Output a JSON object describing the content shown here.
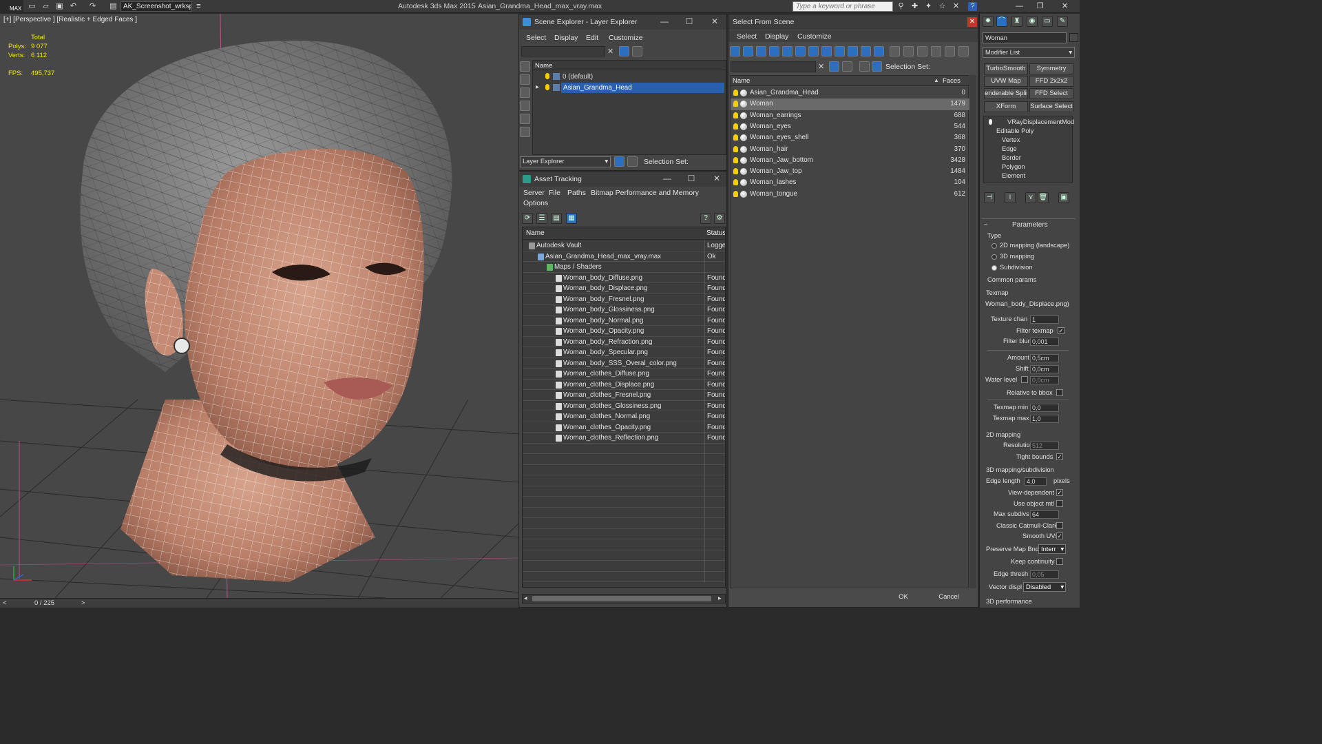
{
  "titlebar": {
    "app_title": "Autodesk 3ds Max  2015",
    "file_title": "Asian_Grandma_Head_max_vray.max",
    "workspace": "AK_Screenshot_wrksp",
    "search_placeholder": "Type a keyword or phrase",
    "icon_label": "MAX"
  },
  "viewport": {
    "label": "[+] [Perspective ] [Realistic + Edged Faces ]",
    "total_label": "Total",
    "polys_label": "Polys:",
    "polys_value": "9 077",
    "verts_label": "Verts:",
    "verts_value": "6 112",
    "fps_label": "FPS:",
    "fps_value": "495,737"
  },
  "timeline": {
    "position": "0 / 225",
    "prev": "<",
    "next": ">"
  },
  "scene_explorer": {
    "title": "Scene Explorer - Layer Explorer",
    "menus": [
      "Select",
      "Display",
      "Edit",
      "Customize"
    ],
    "column": "Name",
    "layers": [
      {
        "name": "0 (default)",
        "selected": false
      },
      {
        "name": "Asian_Grandma_Head",
        "selected": true
      }
    ],
    "footer_dropdown": "Layer Explorer",
    "selection_set_label": "Selection Set:"
  },
  "asset_tracking": {
    "title": "Asset Tracking",
    "menus": [
      "Server",
      "File",
      "Paths",
      "Bitmap Performance and Memory",
      "Options"
    ],
    "columns": [
      "Name",
      "Status"
    ],
    "rows": [
      {
        "name": "Autodesk Vault",
        "status": "Logged",
        "indent": 0,
        "type": "vault"
      },
      {
        "name": "Asian_Grandma_Head_max_vray.max",
        "status": "Ok",
        "indent": 1,
        "type": "file"
      },
      {
        "name": "Maps / Shaders",
        "status": "",
        "indent": 2,
        "type": "folder"
      },
      {
        "name": "Woman_body_Diffuse.png",
        "status": "Found",
        "indent": 3,
        "type": "map"
      },
      {
        "name": "Woman_body_Displace.png",
        "status": "Found",
        "indent": 3,
        "type": "map"
      },
      {
        "name": "Woman_body_Fresnel.png",
        "status": "Found",
        "indent": 3,
        "type": "map"
      },
      {
        "name": "Woman_body_Glossiness.png",
        "status": "Found",
        "indent": 3,
        "type": "map"
      },
      {
        "name": "Woman_body_Normal.png",
        "status": "Found",
        "indent": 3,
        "type": "map"
      },
      {
        "name": "Woman_body_Opacity.png",
        "status": "Found",
        "indent": 3,
        "type": "map"
      },
      {
        "name": "Woman_body_Refraction.png",
        "status": "Found",
        "indent": 3,
        "type": "map"
      },
      {
        "name": "Woman_body_Specular.png",
        "status": "Found",
        "indent": 3,
        "type": "map"
      },
      {
        "name": "Woman_body_SSS_Overal_color.png",
        "status": "Found",
        "indent": 3,
        "type": "map"
      },
      {
        "name": "Woman_clothes_Diffuse.png",
        "status": "Found",
        "indent": 3,
        "type": "map"
      },
      {
        "name": "Woman_clothes_Displace.png",
        "status": "Found",
        "indent": 3,
        "type": "map"
      },
      {
        "name": "Woman_clothes_Fresnel.png",
        "status": "Found",
        "indent": 3,
        "type": "map"
      },
      {
        "name": "Woman_clothes_Glossiness.png",
        "status": "Found",
        "indent": 3,
        "type": "map"
      },
      {
        "name": "Woman_clothes_Normal.png",
        "status": "Found",
        "indent": 3,
        "type": "map"
      },
      {
        "name": "Woman_clothes_Opacity.png",
        "status": "Found",
        "indent": 3,
        "type": "map"
      },
      {
        "name": "Woman_clothes_Reflection.png",
        "status": "Found",
        "indent": 3,
        "type": "map"
      }
    ]
  },
  "select_from_scene": {
    "title": "Select From Scene",
    "menus": [
      "Select",
      "Display",
      "Customize"
    ],
    "selection_set_label": "Selection Set:",
    "columns": [
      "Name",
      "Faces"
    ],
    "objects": [
      {
        "name": "Asian_Grandma_Head",
        "faces": "0",
        "selected": false
      },
      {
        "name": "Woman",
        "faces": "1479",
        "selected": true
      },
      {
        "name": "Woman_earrings",
        "faces": "688",
        "selected": false
      },
      {
        "name": "Woman_eyes",
        "faces": "544",
        "selected": false
      },
      {
        "name": "Woman_eyes_shell",
        "faces": "368",
        "selected": false
      },
      {
        "name": "Woman_hair",
        "faces": "370",
        "selected": false
      },
      {
        "name": "Woman_Jaw_bottom",
        "faces": "3428",
        "selected": false
      },
      {
        "name": "Woman_Jaw_top",
        "faces": "1484",
        "selected": false
      },
      {
        "name": "Woman_lashes",
        "faces": "104",
        "selected": false
      },
      {
        "name": "Woman_tongue",
        "faces": "612",
        "selected": false
      }
    ],
    "ok": "OK",
    "cancel": "Cancel"
  },
  "command_panel": {
    "object_name": "Woman",
    "modifier_list": "Modifier List",
    "buttons": [
      "TurboSmooth",
      "Symmetry",
      "UVW Map",
      "FFD 2x2x2",
      "enderable Splir",
      "FFD Select",
      "XForm",
      "Surface Select"
    ],
    "stack": [
      {
        "name": "VRayDisplacementMod",
        "level": 0
      },
      {
        "name": "Editable Poly",
        "level": 0
      },
      {
        "name": "Vertex",
        "level": 1
      },
      {
        "name": "Edge",
        "level": 1
      },
      {
        "name": "Border",
        "level": 1
      },
      {
        "name": "Polygon",
        "level": 1
      },
      {
        "name": "Element",
        "level": 1
      }
    ],
    "params_title": "Parameters",
    "type_label": "Type",
    "types": [
      "2D mapping (landscape)",
      "3D mapping",
      "Subdivision"
    ],
    "selected_type": 2,
    "common_label": "Common params",
    "texmap_label": "Texmap",
    "texmap_value": "Woman_body_Displace.png)",
    "texture_chan_label": "Texture chan",
    "texture_chan_value": "1",
    "filter_texmap_label": "Filter texmap",
    "filter_blur_label": "Filter blur",
    "filter_blur_value": "0,001",
    "amount_label": "Amount",
    "amount_value": "0,5cm",
    "shift_label": "Shift",
    "shift_value": "0,0cm",
    "water_label": "Water level",
    "water_value": "0,0cm",
    "relative_label": "Relative to bbox",
    "texmap_min_label": "Texmap min",
    "texmap_min_value": "0,0",
    "texmap_max_label": "Texmap max",
    "texmap_max_value": "1,0",
    "mapping2d_label": "2D mapping",
    "resolution_label": "Resolution",
    "resolution_value": "512",
    "tight_label": "Tight bounds",
    "mapping3d_label": "3D mapping/subdivision",
    "edge_length_label": "Edge length",
    "edge_length_value": "4,0",
    "pixels_label": "pixels",
    "view_dep_label": "View-dependent",
    "use_obj_label": "Use object mtl",
    "max_subdivs_label": "Max subdivs",
    "max_subdivs_value": "64",
    "classic_label": "Classic Catmull-Clark",
    "smooth_uvs_label": "Smooth UVs",
    "preserve_label": "Preserve Map Bnd",
    "preserve_value": "Interr",
    "keep_cont_label": "Keep continuity",
    "edge_thresh_label": "Edge thresh",
    "edge_thresh_value": "0,05",
    "vector_label": "Vector displ",
    "vector_value": "Disabled",
    "perf_label": "3D performance"
  }
}
